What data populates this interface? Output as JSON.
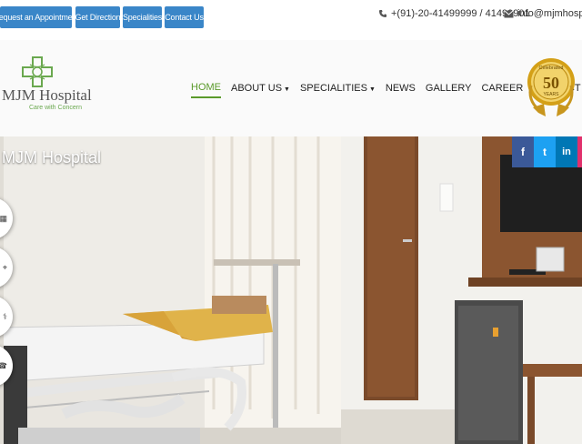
{
  "topbar": {
    "buttons": [
      {
        "label": "Request an Appointment"
      },
      {
        "label": "Get Direction"
      },
      {
        "label": "Specialities"
      },
      {
        "label": "Contact Us"
      }
    ],
    "phone": "+(91)-20-41499999 / 41499901",
    "email": "info@mjmhospita",
    "phone_icon": "phone-icon",
    "email_icon": "envelope-icon"
  },
  "header": {
    "logo_name": "MJM Hospital",
    "logo_tagline": "Care with Concern",
    "badge": {
      "top": "Celebrated",
      "number": "50",
      "bottom": "YEARS"
    }
  },
  "nav": {
    "items": [
      {
        "label": "HOME",
        "active": true,
        "dropdown": false
      },
      {
        "label": "ABOUT US",
        "active": false,
        "dropdown": true
      },
      {
        "label": "SPECIALITIES",
        "active": false,
        "dropdown": true
      },
      {
        "label": "NEWS",
        "active": false,
        "dropdown": false
      },
      {
        "label": "GALLERY",
        "active": false,
        "dropdown": false
      },
      {
        "label": "CAREER",
        "active": false,
        "dropdown": false
      },
      {
        "label": "CONTACT US",
        "active": false,
        "dropdown": false
      }
    ]
  },
  "hero": {
    "title": "MJM Hospital",
    "social": [
      {
        "icon": "facebook-icon",
        "glyph": "f",
        "color": "#3b5998"
      },
      {
        "icon": "twitter-icon",
        "glyph": "t",
        "color": "#1da1f2"
      },
      {
        "icon": "linkedin-icon",
        "glyph": "in",
        "color": "#0077b5"
      }
    ]
  },
  "colors": {
    "accent": "#5a9a2a",
    "button": "#3a86c8"
  }
}
